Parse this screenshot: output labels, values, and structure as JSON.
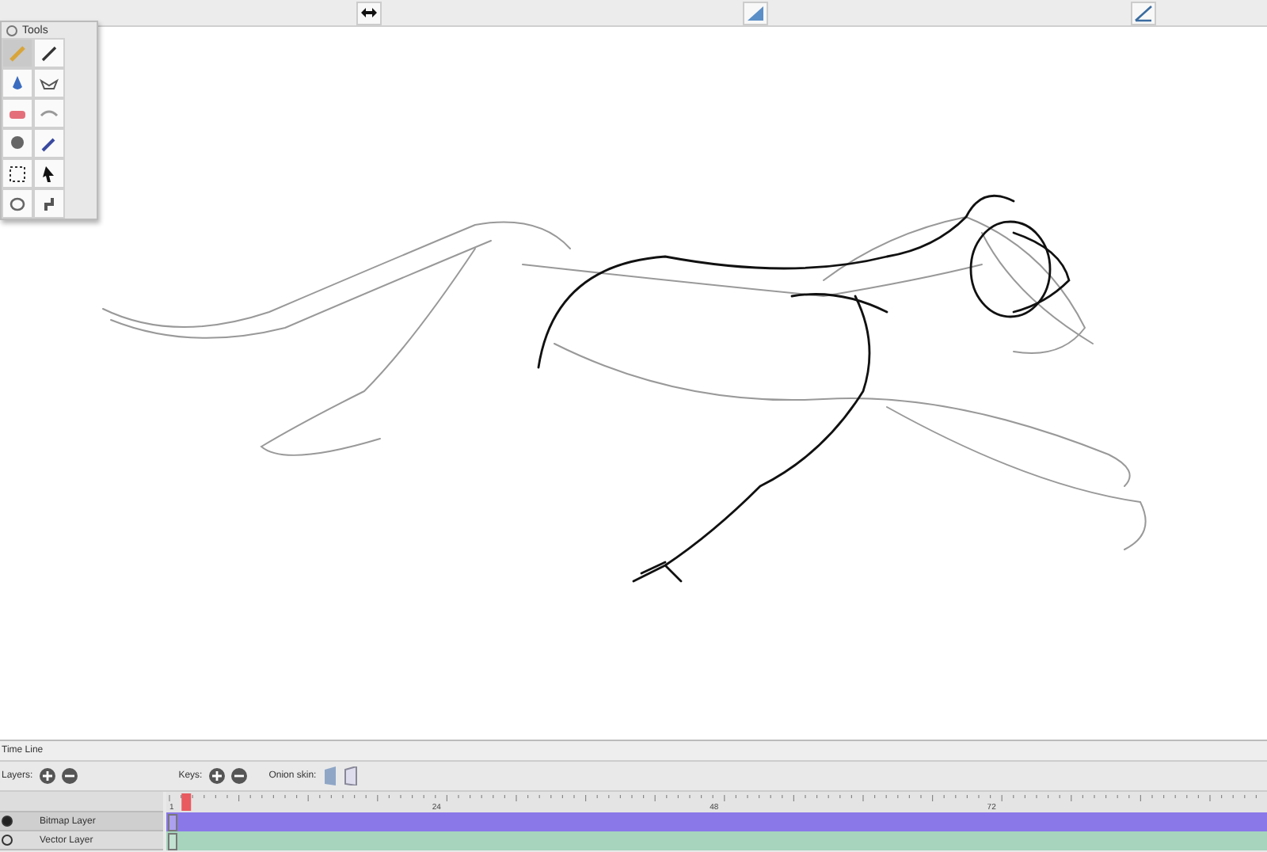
{
  "toolbar": {
    "buttons": [
      {
        "kind": "arrows"
      },
      {
        "kind": "fill"
      },
      {
        "kind": "line"
      }
    ]
  },
  "tools_palette": {
    "title": "Tools",
    "tools": [
      {
        "kind": "pencil",
        "selected": true
      },
      {
        "kind": "brush",
        "selected": false
      },
      {
        "kind": "ink",
        "selected": false
      },
      {
        "kind": "shapes",
        "selected": false
      },
      {
        "kind": "eraser",
        "selected": false
      },
      {
        "kind": "smudge",
        "selected": false
      },
      {
        "kind": "paint",
        "selected": false
      },
      {
        "kind": "dropper",
        "selected": false
      },
      {
        "kind": "select",
        "selected": false
      },
      {
        "kind": "arrow",
        "selected": false
      },
      {
        "kind": "lasso",
        "selected": false
      },
      {
        "kind": "hand",
        "selected": false
      }
    ]
  },
  "timeline": {
    "title": "Time Line",
    "layers_label": "Layers:",
    "keys_label": "Keys:",
    "onion_label": "Onion skin:",
    "ruler_labels": [
      "1",
      "24",
      "48",
      "72"
    ],
    "playhead": {
      "level": 0.011
    },
    "layers": [
      {
        "name": "Bitmap Layer",
        "color": "#8a78e8",
        "selected": true,
        "visible": true
      },
      {
        "name": "Vector Layer",
        "color": "#a6d4bd",
        "selected": false,
        "visible": false
      }
    ]
  }
}
